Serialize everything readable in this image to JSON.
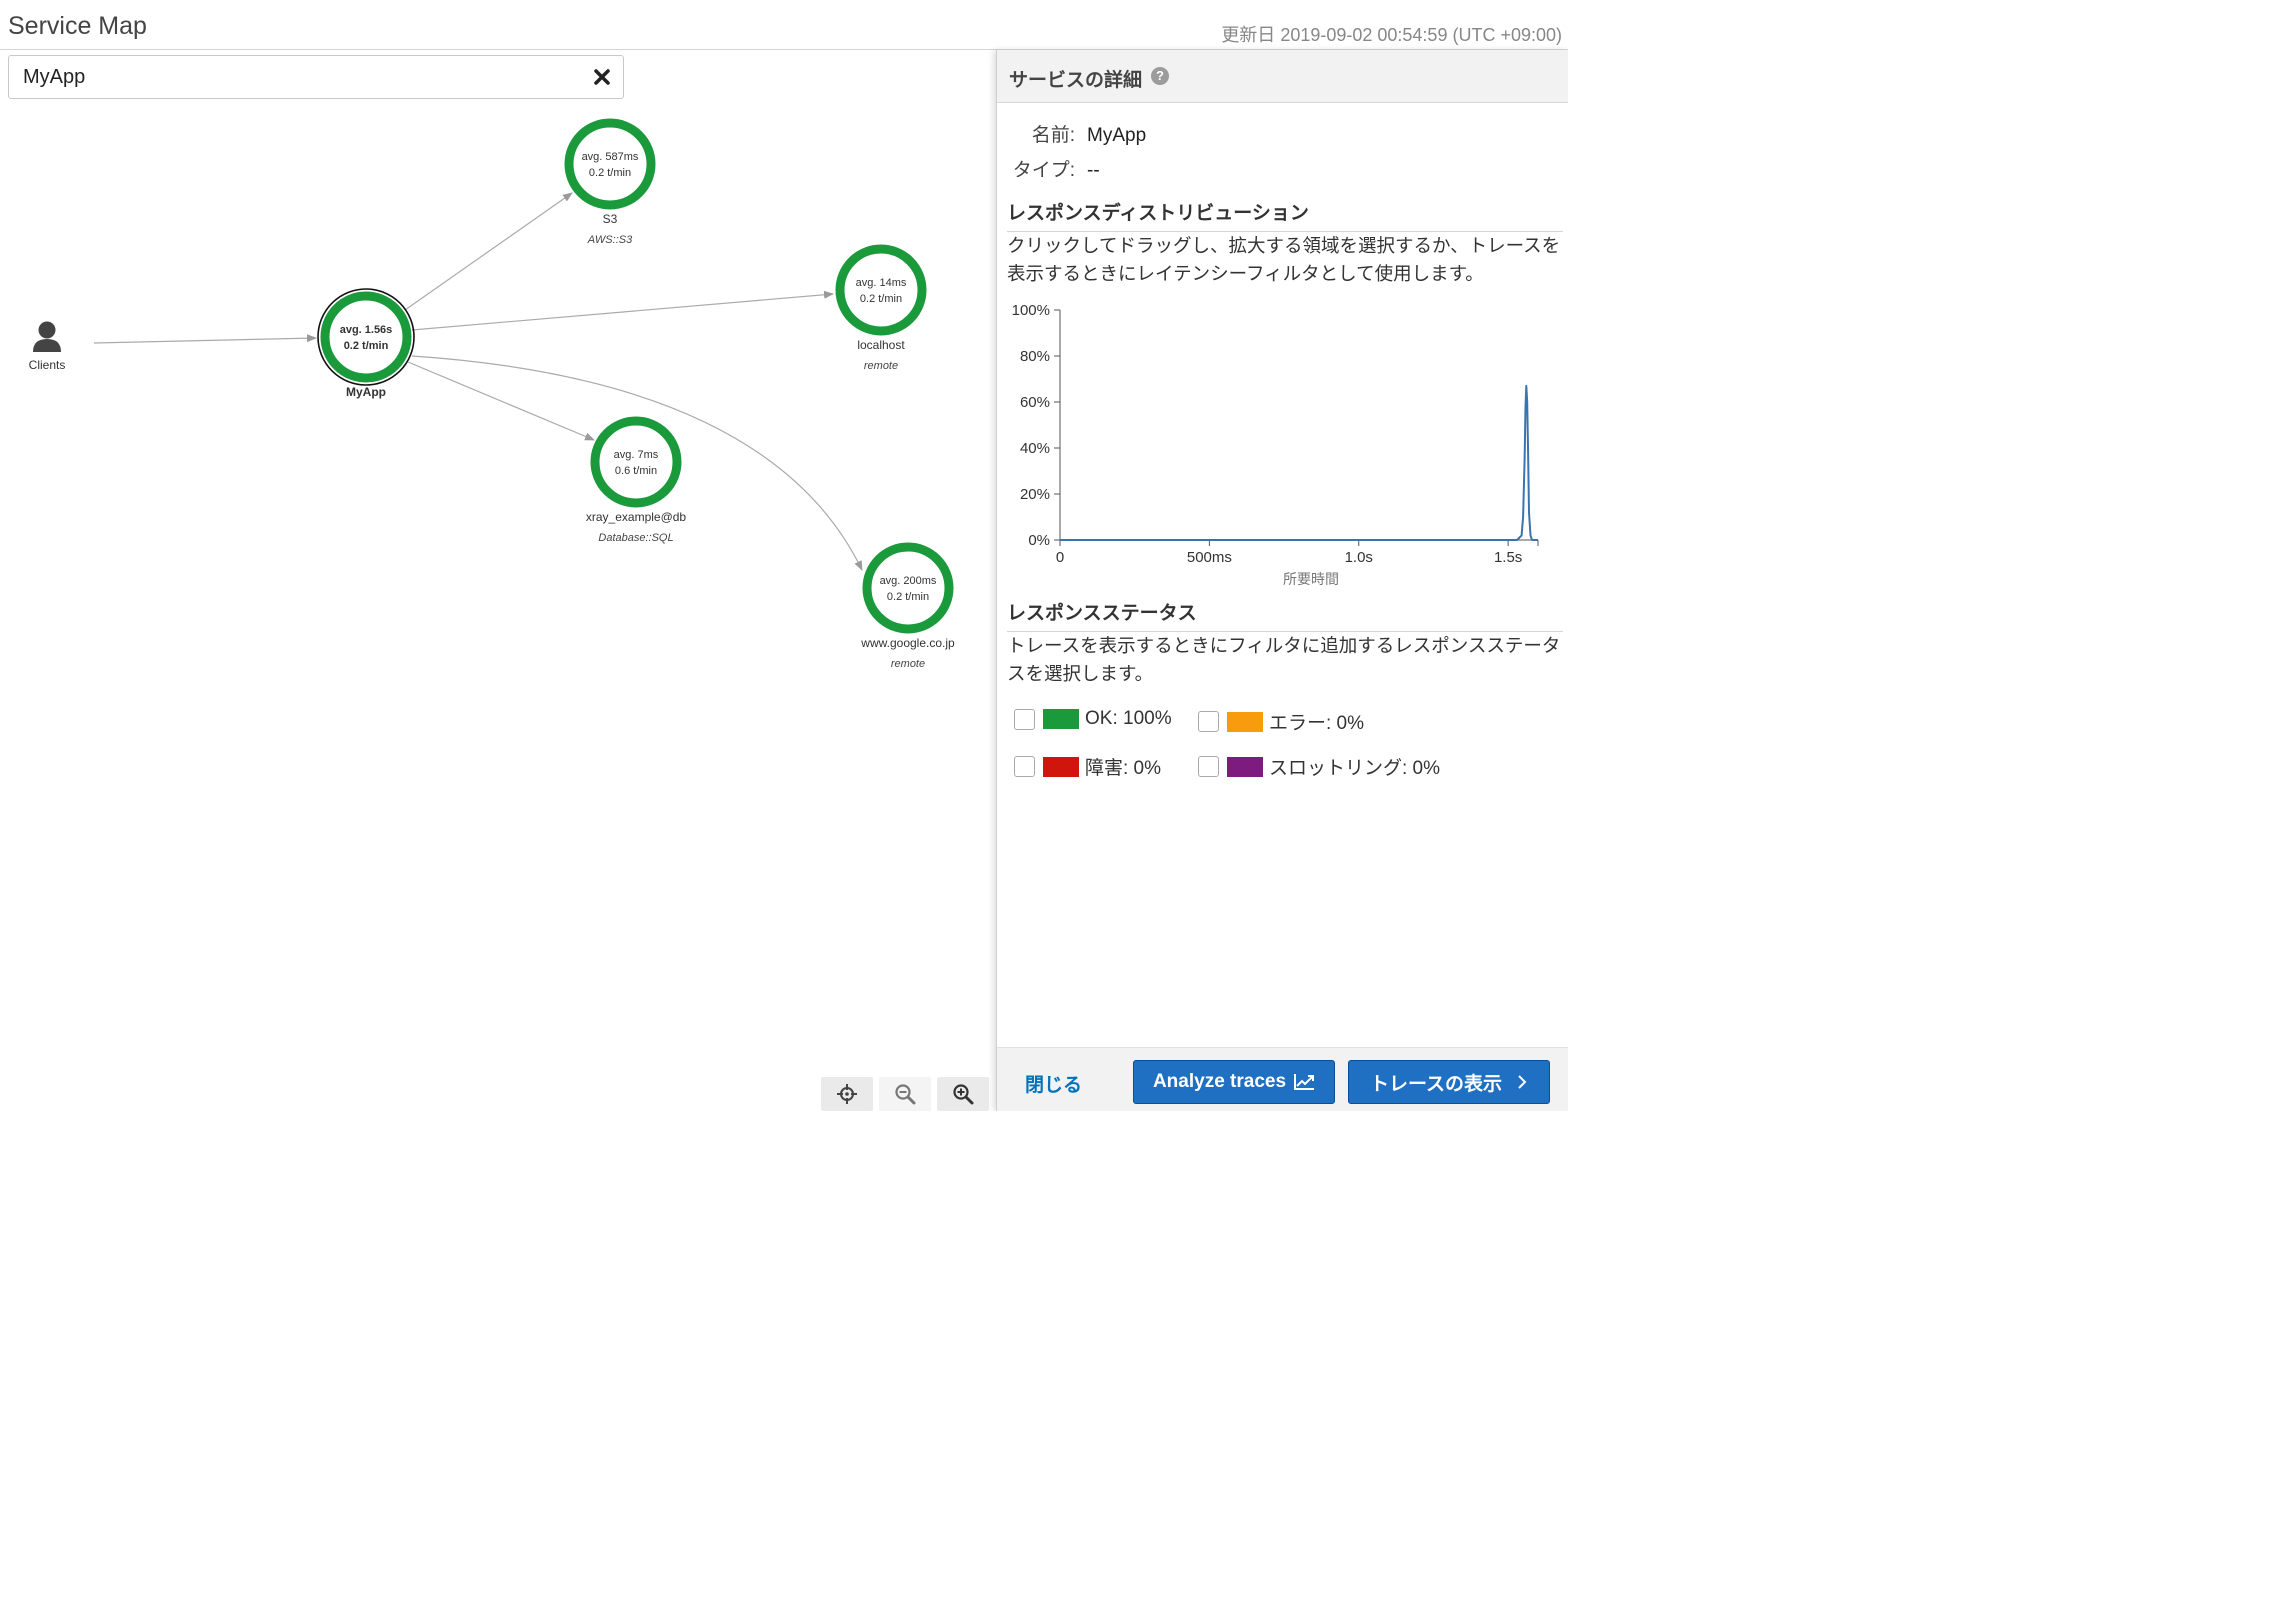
{
  "header": {
    "title": "Service Map",
    "last_updated": "更新日 2019-09-02 00:54:59 (UTC +09:00)"
  },
  "filter": {
    "value": "MyApp",
    "clear_icon": "close-icon"
  },
  "map": {
    "clients": {
      "label": "Clients",
      "icon": "user-icon"
    },
    "nodes": [
      {
        "id": "myapp",
        "name": "MyApp",
        "avg": "avg. 1.56s",
        "rate": "0.2 t/min",
        "type": "",
        "selected": true,
        "ok_fraction": 1.0,
        "color": "#1a9a3b"
      },
      {
        "id": "s3",
        "name": "S3",
        "avg": "avg. 587ms",
        "rate": "0.2 t/min",
        "type": "AWS::S3",
        "ok_fraction": 1.0,
        "color": "#1a9a3b"
      },
      {
        "id": "localhost",
        "name": "localhost",
        "avg": "avg. 14ms",
        "rate": "0.2 t/min",
        "type": "remote",
        "ok_fraction": 1.0,
        "color": "#1a9a3b"
      },
      {
        "id": "db",
        "name": "xray_example@db",
        "avg": "avg. 7ms",
        "rate": "0.6 t/min",
        "type": "Database::SQL",
        "ok_fraction": 1.0,
        "color": "#1a9a3b"
      },
      {
        "id": "google",
        "name": "www.google.co.jp",
        "avg": "avg. 200ms",
        "rate": "0.2 t/min",
        "type": "remote",
        "ok_fraction": 1.0,
        "color": "#1a9a3b"
      }
    ],
    "controls": [
      {
        "name": "center-map-button",
        "icon": "crosshair-icon"
      },
      {
        "name": "zoom-out-button",
        "icon": "zoom-out-icon"
      },
      {
        "name": "zoom-in-button",
        "icon": "zoom-in-icon"
      }
    ]
  },
  "details": {
    "title": "サービスの詳細",
    "help_icon": "?",
    "name_label": "名前:",
    "name_value": "MyApp",
    "type_label": "タイプ:",
    "type_value": "--",
    "dist_heading": "レスポンスディストリビューション",
    "dist_desc": "クリックしてドラッグし、拡大する領域を選択するか、トレースを表示するときにレイテンシーフィルタとして使用します。",
    "status_heading": "レスポンスステータス",
    "status_desc": "トレースを表示するときにフィルタに追加するレスポンスステータスを選択します。",
    "statuses": [
      {
        "label": "OK: 100%",
        "color": "#1a9a3b",
        "checked": false
      },
      {
        "label": "エラー: 0%",
        "color": "#f89c0e",
        "checked": false
      },
      {
        "label": "障害: 0%",
        "color": "#d0160c",
        "checked": false
      },
      {
        "label": "スロットリング: 0%",
        "color": "#7d1b7e",
        "checked": false
      }
    ],
    "close_label": "閉じる",
    "analyze_label": "Analyze traces",
    "view_traces_label": "トレースの表示"
  },
  "chart_data": {
    "type": "line",
    "title": "",
    "xlabel": "所要時間",
    "ylabel": "",
    "xlim": [
      0,
      1.6
    ],
    "ylim": [
      0,
      100
    ],
    "x_ticks": [
      "0",
      "500ms",
      "1.0s",
      "1.5s"
    ],
    "y_ticks": [
      "0%",
      "20%",
      "40%",
      "60%",
      "80%",
      "100%"
    ],
    "grid": false,
    "series": [
      {
        "color": "#3a74b0",
        "x": [
          0,
          1.5,
          1.53,
          1.545,
          1.55,
          1.555,
          1.558,
          1.561,
          1.564,
          1.567,
          1.57,
          1.575,
          1.58,
          1.6
        ],
        "y": [
          0,
          0,
          0,
          2,
          10,
          35,
          58,
          67,
          60,
          38,
          12,
          2,
          0,
          0
        ]
      }
    ]
  }
}
